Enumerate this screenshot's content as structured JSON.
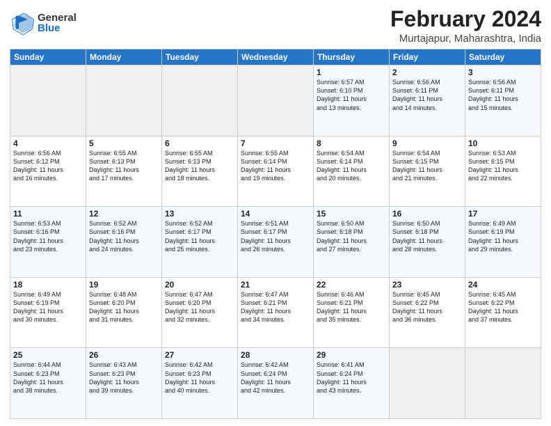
{
  "logo": {
    "general": "General",
    "blue": "Blue"
  },
  "header": {
    "title": "February 2024",
    "subtitle": "Murtajapur, Maharashtra, India"
  },
  "days_of_week": [
    "Sunday",
    "Monday",
    "Tuesday",
    "Wednesday",
    "Thursday",
    "Friday",
    "Saturday"
  ],
  "weeks": [
    [
      {
        "day": "",
        "info": ""
      },
      {
        "day": "",
        "info": ""
      },
      {
        "day": "",
        "info": ""
      },
      {
        "day": "",
        "info": ""
      },
      {
        "day": "1",
        "info": "Sunrise: 6:57 AM\nSunset: 6:10 PM\nDaylight: 11 hours\nand 13 minutes."
      },
      {
        "day": "2",
        "info": "Sunrise: 6:56 AM\nSunset: 6:11 PM\nDaylight: 11 hours\nand 14 minutes."
      },
      {
        "day": "3",
        "info": "Sunrise: 6:56 AM\nSunset: 6:11 PM\nDaylight: 11 hours\nand 15 minutes."
      }
    ],
    [
      {
        "day": "4",
        "info": "Sunrise: 6:56 AM\nSunset: 6:12 PM\nDaylight: 11 hours\nand 16 minutes."
      },
      {
        "day": "5",
        "info": "Sunrise: 6:55 AM\nSunset: 6:13 PM\nDaylight: 11 hours\nand 17 minutes."
      },
      {
        "day": "6",
        "info": "Sunrise: 6:55 AM\nSunset: 6:13 PM\nDaylight: 11 hours\nand 18 minutes."
      },
      {
        "day": "7",
        "info": "Sunrise: 6:55 AM\nSunset: 6:14 PM\nDaylight: 11 hours\nand 19 minutes."
      },
      {
        "day": "8",
        "info": "Sunrise: 6:54 AM\nSunset: 6:14 PM\nDaylight: 11 hours\nand 20 minutes."
      },
      {
        "day": "9",
        "info": "Sunrise: 6:54 AM\nSunset: 6:15 PM\nDaylight: 11 hours\nand 21 minutes."
      },
      {
        "day": "10",
        "info": "Sunrise: 6:53 AM\nSunset: 6:15 PM\nDaylight: 11 hours\nand 22 minutes."
      }
    ],
    [
      {
        "day": "11",
        "info": "Sunrise: 6:53 AM\nSunset: 6:16 PM\nDaylight: 11 hours\nand 23 minutes."
      },
      {
        "day": "12",
        "info": "Sunrise: 6:52 AM\nSunset: 6:16 PM\nDaylight: 11 hours\nand 24 minutes."
      },
      {
        "day": "13",
        "info": "Sunrise: 6:52 AM\nSunset: 6:17 PM\nDaylight: 11 hours\nand 25 minutes."
      },
      {
        "day": "14",
        "info": "Sunrise: 6:51 AM\nSunset: 6:17 PM\nDaylight: 11 hours\nand 26 minutes."
      },
      {
        "day": "15",
        "info": "Sunrise: 6:50 AM\nSunset: 6:18 PM\nDaylight: 11 hours\nand 27 minutes."
      },
      {
        "day": "16",
        "info": "Sunrise: 6:50 AM\nSunset: 6:18 PM\nDaylight: 11 hours\nand 28 minutes."
      },
      {
        "day": "17",
        "info": "Sunrise: 6:49 AM\nSunset: 6:19 PM\nDaylight: 11 hours\nand 29 minutes."
      }
    ],
    [
      {
        "day": "18",
        "info": "Sunrise: 6:49 AM\nSunset: 6:19 PM\nDaylight: 11 hours\nand 30 minutes."
      },
      {
        "day": "19",
        "info": "Sunrise: 6:48 AM\nSunset: 6:20 PM\nDaylight: 11 hours\nand 31 minutes."
      },
      {
        "day": "20",
        "info": "Sunrise: 6:47 AM\nSunset: 6:20 PM\nDaylight: 11 hours\nand 32 minutes."
      },
      {
        "day": "21",
        "info": "Sunrise: 6:47 AM\nSunset: 6:21 PM\nDaylight: 11 hours\nand 34 minutes."
      },
      {
        "day": "22",
        "info": "Sunrise: 6:46 AM\nSunset: 6:21 PM\nDaylight: 11 hours\nand 35 minutes."
      },
      {
        "day": "23",
        "info": "Sunrise: 6:45 AM\nSunset: 6:22 PM\nDaylight: 11 hours\nand 36 minutes."
      },
      {
        "day": "24",
        "info": "Sunrise: 6:45 AM\nSunset: 6:22 PM\nDaylight: 11 hours\nand 37 minutes."
      }
    ],
    [
      {
        "day": "25",
        "info": "Sunrise: 6:44 AM\nSunset: 6:23 PM\nDaylight: 11 hours\nand 38 minutes."
      },
      {
        "day": "26",
        "info": "Sunrise: 6:43 AM\nSunset: 6:23 PM\nDaylight: 11 hours\nand 39 minutes."
      },
      {
        "day": "27",
        "info": "Sunrise: 6:42 AM\nSunset: 6:23 PM\nDaylight: 11 hours\nand 40 minutes."
      },
      {
        "day": "28",
        "info": "Sunrise: 6:42 AM\nSunset: 6:24 PM\nDaylight: 11 hours\nand 42 minutes."
      },
      {
        "day": "29",
        "info": "Sunrise: 6:41 AM\nSunset: 6:24 PM\nDaylight: 11 hours\nand 43 minutes."
      },
      {
        "day": "",
        "info": ""
      },
      {
        "day": "",
        "info": ""
      }
    ]
  ]
}
